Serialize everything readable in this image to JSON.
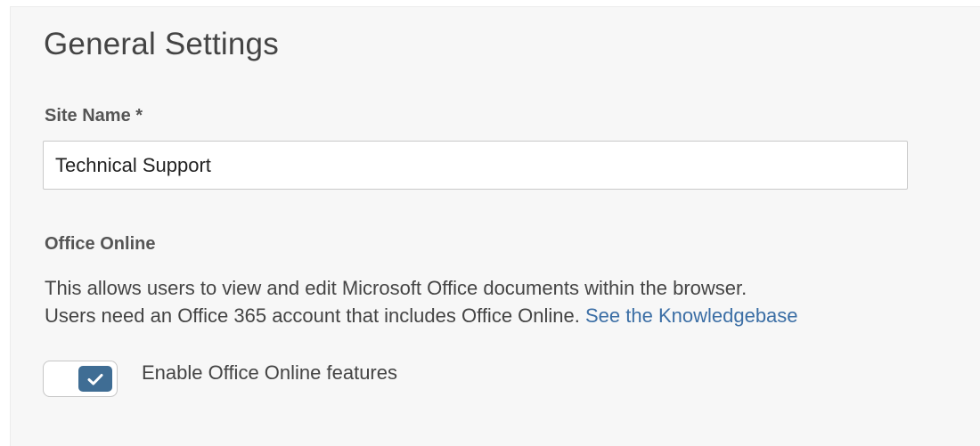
{
  "settings": {
    "title": "General Settings",
    "site_name": {
      "label": "Site Name *",
      "value": "Technical Support"
    },
    "office_online": {
      "heading": "Office Online",
      "description_line1": "This allows users to view and edit Microsoft Office documents within the browser.",
      "description_line2": "Users need an Office 365 account that includes Office Online.",
      "link_text": "See the Knowledgebase",
      "toggle": {
        "label": "Enable Office Online features",
        "checked": true,
        "icon": "checkmark-icon"
      }
    }
  },
  "colors": {
    "accent": "#3f6d94",
    "link": "#3b6ea5",
    "panel_bg": "#f7f7f7"
  }
}
